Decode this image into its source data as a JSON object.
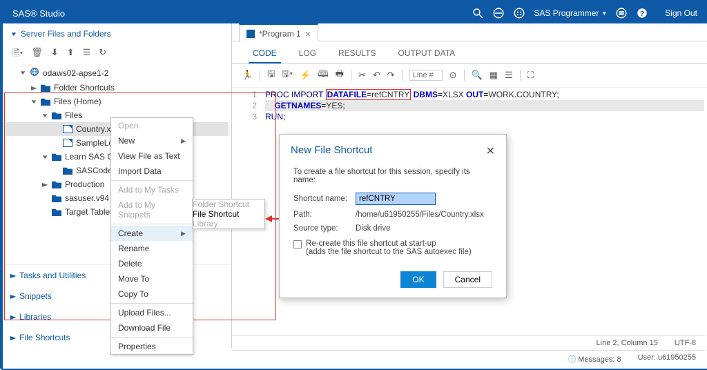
{
  "app_title": "SAS® Studio",
  "header": {
    "user": "SAS Programmer",
    "signout": "Sign Out"
  },
  "sidebar": {
    "title": "Server Files and Folders",
    "tree": {
      "root": "odaws02-apse1-2",
      "items": [
        {
          "label": "Folder Shortcuts",
          "type": "folder",
          "indent": 2,
          "exp": "▶"
        },
        {
          "label": "Files (Home)",
          "type": "folder",
          "indent": 2,
          "exp": "▼"
        },
        {
          "label": "Files",
          "type": "folder",
          "indent": 3,
          "exp": "▼"
        },
        {
          "label": "Country.xlsx",
          "type": "file",
          "indent": 4,
          "selected": true
        },
        {
          "label": "SampleLog.tx",
          "type": "file",
          "indent": 4
        },
        {
          "label": "Learn SAS Code",
          "type": "folder",
          "indent": 3,
          "exp": "▼"
        },
        {
          "label": "SASCode",
          "type": "folder",
          "indent": 4
        },
        {
          "label": "Production",
          "type": "folder",
          "indent": 3,
          "exp": "▶"
        },
        {
          "label": "sasuser.v94",
          "type": "folder",
          "indent": 3
        },
        {
          "label": "Target Tables",
          "type": "folder",
          "indent": 3
        }
      ]
    },
    "sections": [
      "Tasks and Utilities",
      "Snippets",
      "Libraries",
      "File Shortcuts"
    ]
  },
  "context_menu": {
    "items": [
      {
        "label": "Open",
        "disabled": true
      },
      {
        "label": "New",
        "sub": true
      },
      {
        "label": "View File as Text"
      },
      {
        "label": "Import Data"
      },
      {
        "divider": true
      },
      {
        "label": "Add to My Tasks",
        "disabled": true
      },
      {
        "label": "Add to My Snippets",
        "disabled": true
      },
      {
        "divider": true
      },
      {
        "label": "Create",
        "sub": true,
        "hover": true
      },
      {
        "label": "Rename"
      },
      {
        "label": "Delete"
      },
      {
        "label": "Move To"
      },
      {
        "label": "Copy To"
      },
      {
        "divider": true
      },
      {
        "label": "Upload Files..."
      },
      {
        "label": "Download File"
      },
      {
        "divider": true
      },
      {
        "label": "Properties"
      }
    ],
    "submenu": [
      {
        "label": "Folder Shortcut",
        "disabled": true
      },
      {
        "label": "File Shortcut"
      },
      {
        "label": "Library",
        "disabled": true
      }
    ]
  },
  "editor": {
    "tab": "*Program 1",
    "subtabs": [
      "CODE",
      "LOG",
      "RESULTS",
      "OUTPUT DATA"
    ],
    "line_placeholder": "Line #",
    "lines": [
      "1",
      "2",
      "3"
    ],
    "code": {
      "proc": "PROC",
      "import": "IMPORT",
      "datafile": "DATAFILE",
      "eq": "=",
      "ref": "refCNTRY",
      "dbms": "DBMS",
      "xlsx": "XLSX",
      "out": "OUT",
      "work": "WORK.COUNTRY",
      "getnames": "GETNAMES",
      "yes": "YES",
      "run": "RUN"
    }
  },
  "dialog": {
    "title": "New File Shortcut",
    "desc": "To create a file shortcut for this session, specify its name:",
    "shortcut_label": "Shortcut name:",
    "shortcut_value": "refCNTRY",
    "path_label": "Path:",
    "path_value": "/home/u61950255/Files/Country.xlsx",
    "source_label": "Source type:",
    "source_value": "Disk drive",
    "recreate": "Re-create this file shortcut at start-up",
    "recreate_sub": "(adds the file shortcut to the SAS autoexec file)",
    "ok": "OK",
    "cancel": "Cancel"
  },
  "status": {
    "pos": "Line 2, Column 15",
    "enc": "UTF-8",
    "messages": "Messages: 8",
    "user": "User: u61950255"
  }
}
